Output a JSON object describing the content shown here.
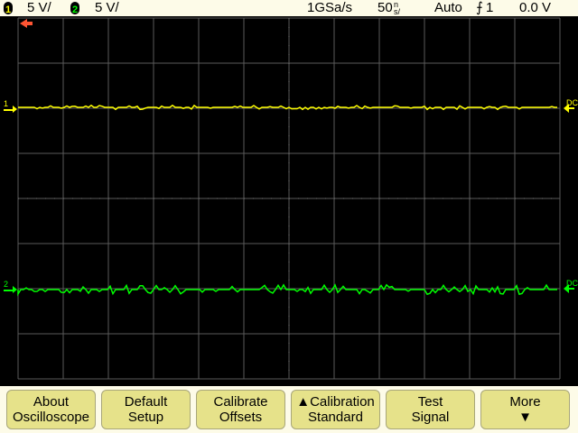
{
  "status_bar": {
    "ch1": {
      "number": "1",
      "scale": "5 V/",
      "color": "#ffff00"
    },
    "ch2": {
      "number": "2",
      "scale": "5 V/",
      "color": "#00ff00"
    },
    "sample_rate": "1GSa/s",
    "timebase_value": "50",
    "timebase_unit_top": "n",
    "timebase_unit_bottom": "s/",
    "trigger_mode": "Auto",
    "trigger_source": "1",
    "trigger_level": "0.0 V"
  },
  "display": {
    "ch1_label": "1",
    "ch2_label": "2",
    "ch1_coupling": "DC",
    "ch2_coupling": "DC",
    "grid_color": "#5a5a5a",
    "trigger_marker_color": "#ff5533"
  },
  "softkeys": [
    {
      "line1": "About",
      "line2": "Oscilloscope"
    },
    {
      "line1": "Default",
      "line2": "Setup"
    },
    {
      "line1": "Calibrate",
      "line2": "Offsets"
    },
    {
      "line1": "▲Calibration",
      "line2": "Standard"
    },
    {
      "line1": "Test",
      "line2": "Signal"
    },
    {
      "line1": "More",
      "line2": "▼"
    }
  ]
}
